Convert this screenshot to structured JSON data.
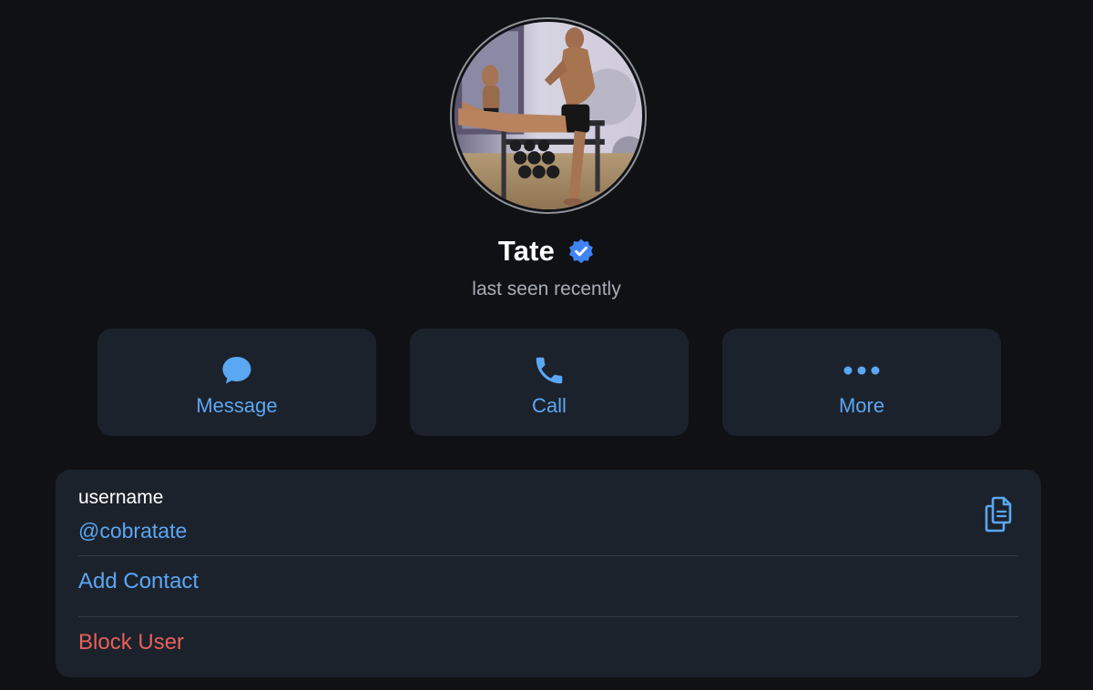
{
  "profile": {
    "name": "Tate",
    "status": "last seen recently",
    "verified_icon": "verified-badge-icon",
    "avatar_desc": "profile-photo"
  },
  "actions": [
    {
      "label": "Message",
      "icon": "chat-bubble-icon"
    },
    {
      "label": "Call",
      "icon": "phone-icon"
    },
    {
      "label": "More",
      "icon": "more-dots-icon"
    }
  ],
  "info": {
    "username_label": "username",
    "username_value": "@cobratate",
    "copy_icon": "copy-icon",
    "add_contact": "Add Contact",
    "block_user": "Block User"
  },
  "colors": {
    "background": "#101114",
    "card": "#1c222b",
    "accent": "#5aa7f4",
    "danger": "#e5605a",
    "secondary_text": "#a7adb7",
    "verified": "#3f84f3"
  }
}
